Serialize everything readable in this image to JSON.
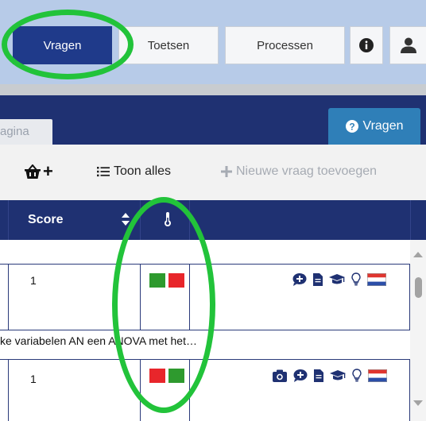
{
  "tabs": {
    "vragen": "Vragen",
    "toetsen": "Toetsen",
    "processen": "Processen"
  },
  "header": {
    "pagina_tab": "agina",
    "help_label": "Vragen"
  },
  "toolbar": {
    "toon_alles": "Toon alles",
    "nieuwe_vraag": "Nieuwe vraag toevoegen"
  },
  "table": {
    "score_header": "Score",
    "rows": [
      {
        "score": "1",
        "statuses": [
          "green",
          "red"
        ]
      },
      {
        "score": "1",
        "statuses": [
          "red",
          "green"
        ]
      }
    ],
    "description": "ke variabelen AN een ANOVA met het…"
  },
  "colors": {
    "navy": "#1f3172",
    "active_tab": "#1f3a8a",
    "status_green": "#2e9a2e",
    "status_red": "#e8262b",
    "annotation": "#22c33a"
  },
  "icons": {
    "row1": [
      "comment-plus-icon",
      "document-icon",
      "graduation-cap-icon",
      "lightbulb-icon",
      "dutch-flag-icon"
    ],
    "row2": [
      "camera-icon",
      "comment-plus-icon",
      "document-icon",
      "graduation-cap-icon",
      "lightbulb-icon",
      "dutch-flag-icon"
    ]
  }
}
